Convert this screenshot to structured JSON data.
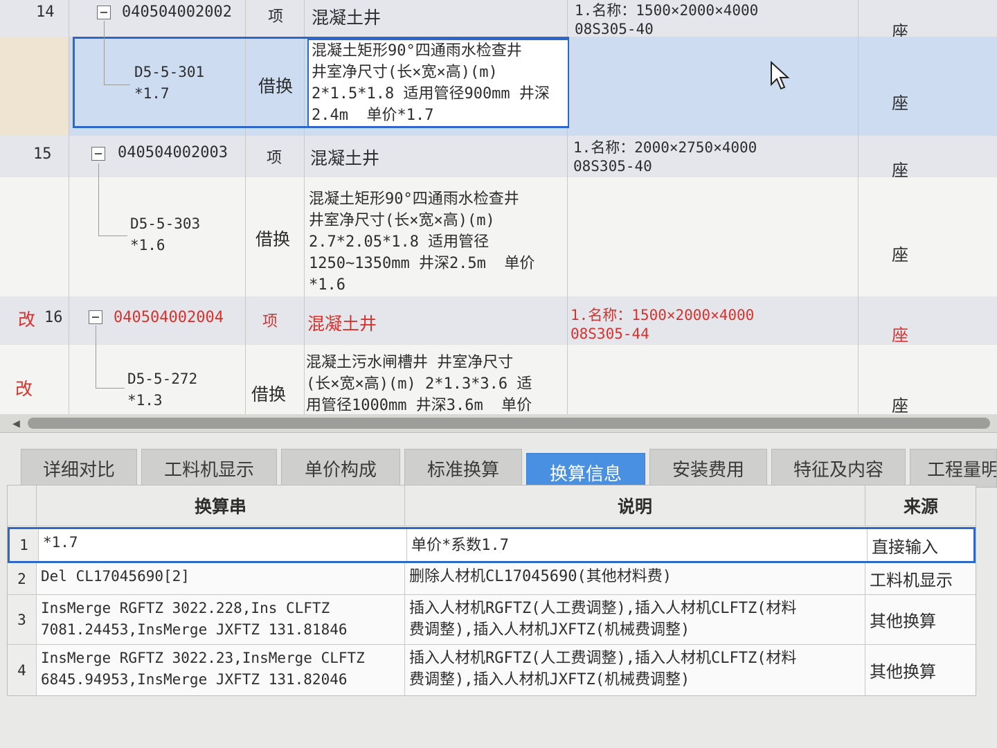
{
  "top_rows": [
    {
      "num": "14",
      "code": "040504002002",
      "unit": "项",
      "name": "混凝土井",
      "features": "1.名称：1500×2000×4000\n08S305-40",
      "unit2": "座"
    },
    {
      "code": "D5-5-301\n*1.7",
      "unit": "借换",
      "name": "混凝土矩形90°四通雨水检查井\n井室净尺寸(长×宽×高)(m)\n2*1.5*1.8 适用管径900mm 井深\n2.4m  单价*1.7",
      "unit2": "座"
    },
    {
      "num": "15",
      "code": "040504002003",
      "unit": "项",
      "name": "混凝土井",
      "features": "1.名称：2000×2750×4000\n08S305-40",
      "unit2": "座"
    },
    {
      "code": "D5-5-303\n*1.6",
      "unit": "借换",
      "name": "混凝土矩形90°四通雨水检查井\n井室净尺寸(长×宽×高)(m)\n2.7*2.05*1.8 适用管径\n1250~1350mm 井深2.5m  单价\n*1.6",
      "unit2": "座"
    },
    {
      "mark": "改",
      "num": "16",
      "code": "040504002004",
      "unit": "项",
      "name": "混凝土井",
      "features": "1.名称：1500×2000×4000\n08S305-44",
      "unit2": "座"
    },
    {
      "mark": "改",
      "code": "D5-5-272\n*1.3",
      "unit": "借换",
      "name": "混凝土污水闸槽井 井室净尺寸\n(长×宽×高)(m) 2*1.3*3.6 适\n用管径1000mm 井深3.6m  单价",
      "unit2": "座"
    }
  ],
  "tabs": [
    "详细对比",
    "工料机显示",
    "单价构成",
    "标准换算",
    "换算信息",
    "安装费用",
    "特征及内容",
    "工程量明"
  ],
  "active_tab": "换算信息",
  "bottom_table": {
    "headers": [
      "换算串",
      "说明",
      "来源"
    ],
    "rows": [
      {
        "idx": "1",
        "str": "*1.7",
        "desc": "单价*系数1.7",
        "src": "直接输入"
      },
      {
        "idx": "2",
        "str": "Del CL17045690[2]",
        "desc": "删除人材机CL17045690(其他材料费)",
        "src": "工料机显示"
      },
      {
        "idx": "3",
        "str": "InsMerge RGFTZ 3022.228,Ins CLFTZ\n7081.24453,InsMerge JXFTZ 131.81846",
        "desc": "插入人材机RGFTZ(人工费调整),插入人材机CLFTZ(材料\n费调整),插入人材机JXFTZ(机械费调整)",
        "src": "其他换算"
      },
      {
        "idx": "4",
        "str": "InsMerge RGFTZ 3022.23,InsMerge CLFTZ\n6845.94953,InsMerge JXFTZ 131.82046",
        "desc": "插入人材机RGFTZ(人工费调整),插入人材机CLFTZ(材料\n费调整),插入人材机JXFTZ(机械费调整)",
        "src": "其他换算"
      }
    ]
  }
}
